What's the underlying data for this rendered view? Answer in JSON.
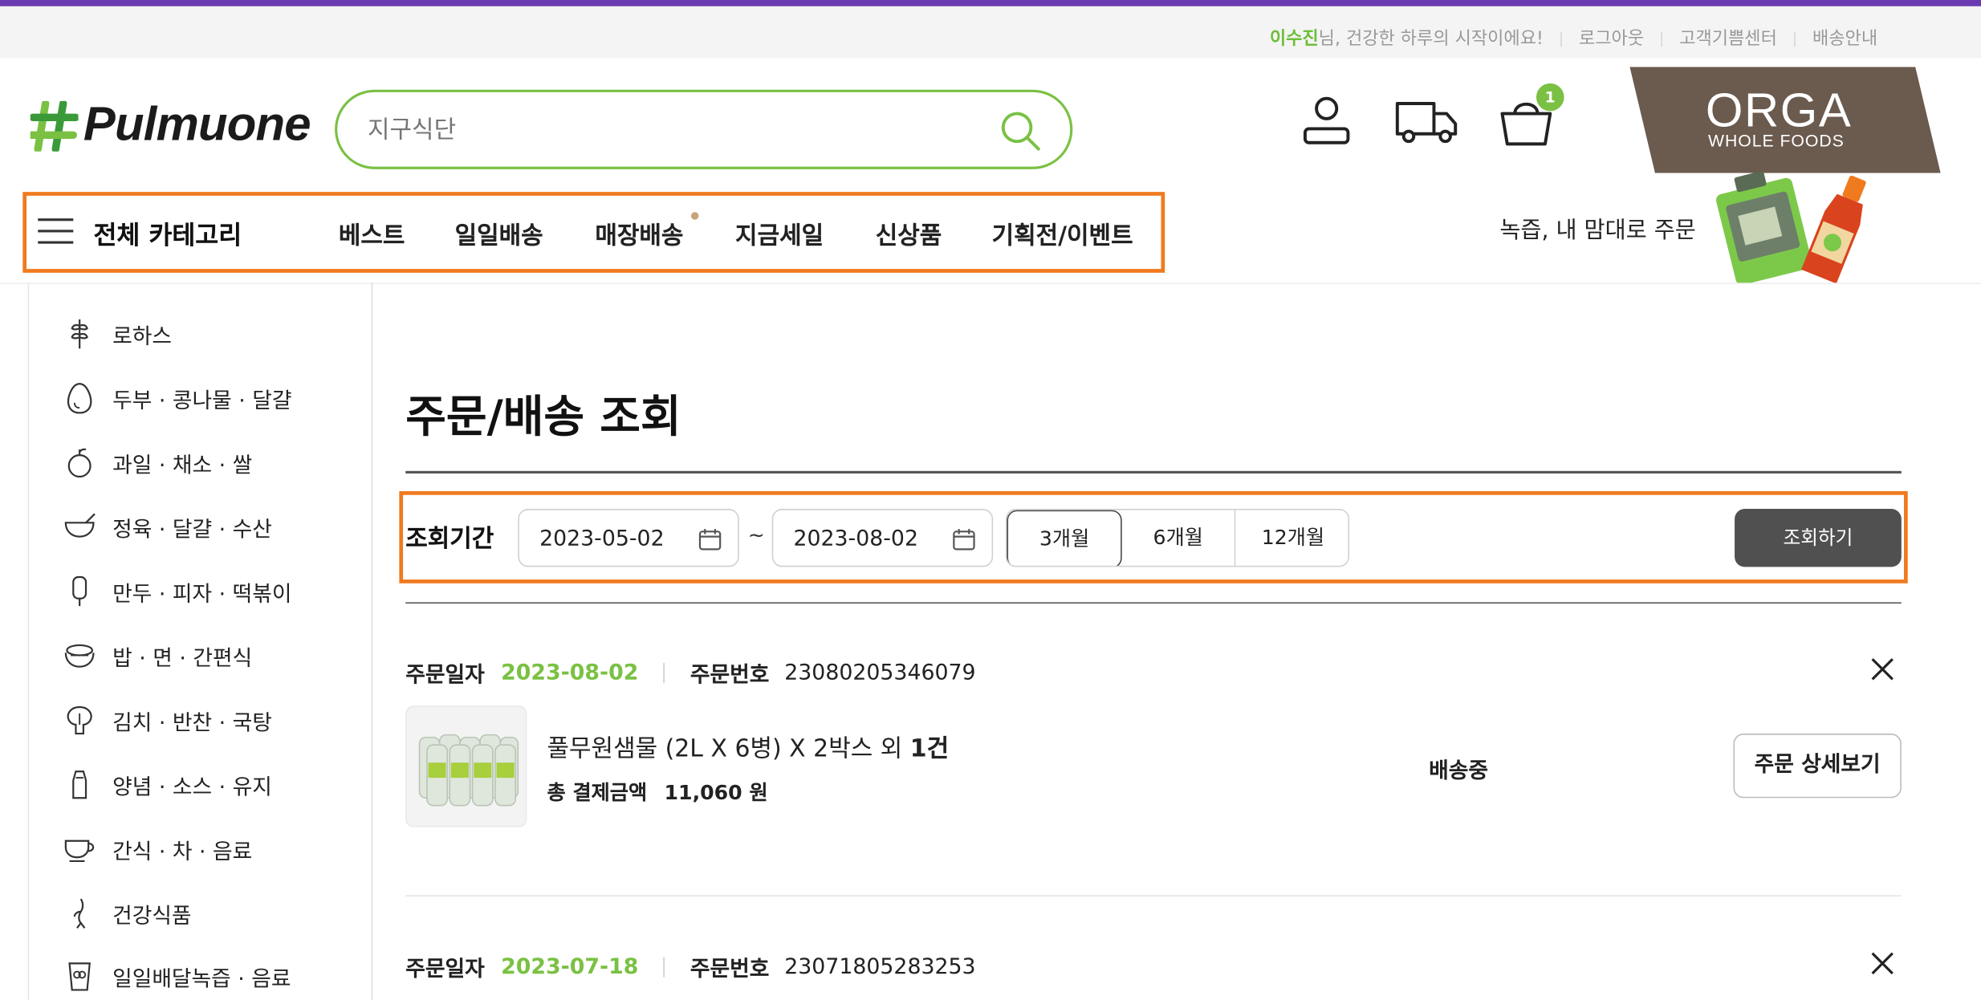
{
  "utility": {
    "user_name": "이수진",
    "greeting": "님, 건강한 하루의 시작이에요!",
    "logout": "로그아웃",
    "customer_center": "고객기쁨센터",
    "delivery_info": "배송안내"
  },
  "header": {
    "logo_text": "Pulmuone",
    "search_placeholder": "지구식단",
    "cart_count": "1",
    "banner_title": "ORGA",
    "banner_subtitle": "WHOLE FOODS",
    "promo_text": "녹즙, 내 맘대로 주문"
  },
  "nav": {
    "all_categories": "전체 카테고리",
    "items": [
      "베스트",
      "일일배송",
      "매장배송",
      "지금세일",
      "신상품",
      "기획전/이벤트"
    ]
  },
  "sidebar": {
    "categories": [
      {
        "label": "로하스",
        "icon": "wheat-icon"
      },
      {
        "label": "두부 · 콩나물 · 달걀",
        "icon": "egg-icon"
      },
      {
        "label": "과일 · 채소 · 쌀",
        "icon": "apple-icon"
      },
      {
        "label": "정육 · 달걀 · 수산",
        "icon": "bowl-icon"
      },
      {
        "label": "만두 · 피자 · 떡볶이",
        "icon": "popsicle-icon"
      },
      {
        "label": "밥 · 면 · 간편식",
        "icon": "rice-bowl-icon"
      },
      {
        "label": "김치 · 반찬 · 국탕",
        "icon": "cabbage-icon"
      },
      {
        "label": "양념 · 소스 · 유지",
        "icon": "sauce-bottle-icon"
      },
      {
        "label": "간식 · 차 · 음료",
        "icon": "cup-icon"
      },
      {
        "label": "건강식품",
        "icon": "ginseng-icon"
      },
      {
        "label": "일일배달녹즙 · 음료",
        "icon": "juice-cup-icon"
      }
    ]
  },
  "main": {
    "page_title": "주문/배송 조회",
    "filter": {
      "label": "조회기간",
      "start_date": "2023-05-02",
      "tilde": "~",
      "end_date": "2023-08-02",
      "periods": [
        "3개월",
        "6개월",
        "12개월"
      ],
      "active_period": "3개월",
      "search_button": "조회하기"
    },
    "orders": [
      {
        "date_label": "주문일자",
        "date": "2023-08-02",
        "number_label": "주문번호",
        "number": "23080205346079",
        "product_name": "풀무원샘물 (2L X 6병) X 2박스 외",
        "extra_count": "1건",
        "total_label": "총 결제금액",
        "total_amount": "11,060",
        "currency": "원",
        "status": "배송중",
        "detail_button": "주문 상세보기"
      },
      {
        "date_label": "주문일자",
        "date": "2023-07-18",
        "number_label": "주문번호",
        "number": "23071805283253"
      }
    ]
  },
  "colors": {
    "brand_green": "#7ac143",
    "accent_purple": "#6a3ab0",
    "highlight_orange": "#f07a1e",
    "orga_brown": "#6b5a4e",
    "button_dark": "#505050"
  }
}
